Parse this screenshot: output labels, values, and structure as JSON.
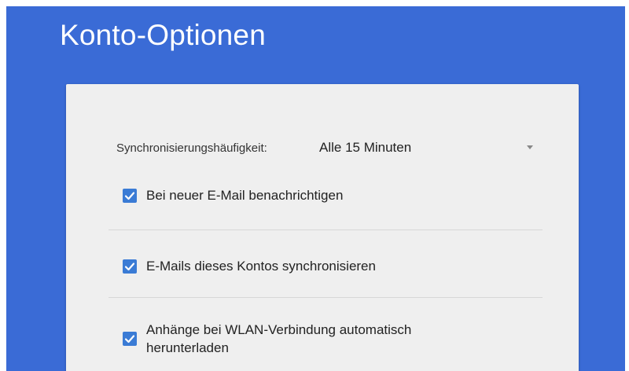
{
  "page": {
    "title": "Konto-Optionen"
  },
  "sync": {
    "label": "Synchronisierungshäufigkeit:",
    "value": "Alle 15 Minuten"
  },
  "options": [
    {
      "label": "Bei neuer E-Mail benachrichtigen",
      "checked": true
    },
    {
      "label": "E-Mails dieses Kontos synchronisieren",
      "checked": true
    },
    {
      "label_line1": "Anhänge bei WLAN-Verbindung automatisch",
      "label_line2": "herunterladen",
      "checked": true
    }
  ],
  "colors": {
    "background": "#3a6bd6",
    "card": "#efefef",
    "checkbox": "#3a7bd5"
  }
}
